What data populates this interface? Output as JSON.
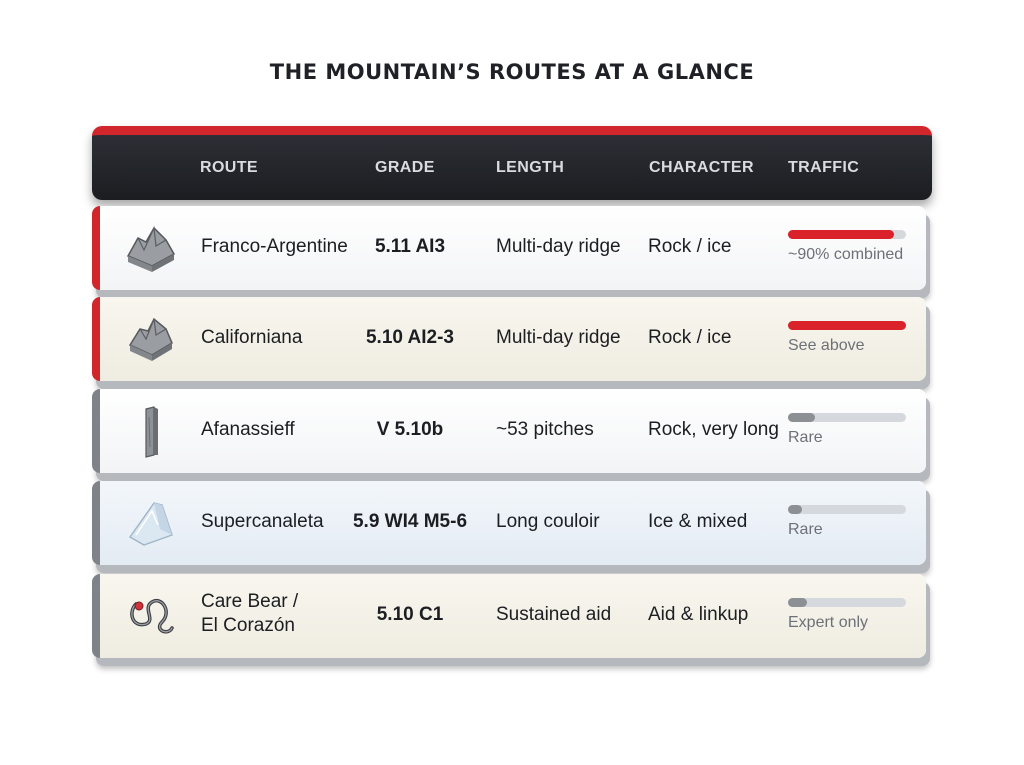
{
  "title": "THE MOUNTAIN’S ROUTES AT A GLANCE",
  "headers": {
    "route": "ROUTE",
    "grade": "GRADE",
    "length": "LENGTH",
    "character": "CHARACTER",
    "traffic": "TRAFFIC"
  },
  "colors": {
    "accent": "#d0262c",
    "header_bg": "#1f2126",
    "traffic_low": "#8c8f94"
  },
  "rows": [
    {
      "route": "Franco-Argentine",
      "grade": "5.11 AI3",
      "length": "Multi-day ridge",
      "character": "Rock / ice",
      "traffic_label": "~90% combined",
      "traffic_level": 0.9,
      "icon": "rock-peak-icon"
    },
    {
      "route": "Californiana",
      "grade": "5.10 AI2-3",
      "length": "Multi-day ridge",
      "character": "Rock / ice",
      "traffic_label": "See above",
      "traffic_level": 1.0,
      "icon": "rock-peak-icon"
    },
    {
      "route": "Afanassieff",
      "grade": "V 5.10b",
      "length": "~53 pitches",
      "character": "Rock, very long",
      "traffic_label": "Rare",
      "traffic_level": 0.23,
      "icon": "rock-pillar-icon"
    },
    {
      "route": "Supercanaleta",
      "grade": "5.9 WI4 M5-6",
      "length": "Long couloir",
      "character": "Ice & mixed",
      "traffic_label": "Rare",
      "traffic_level": 0.12,
      "icon": "ice-block-icon"
    },
    {
      "route_line1": "Care Bear /",
      "route_line2": "El Corazón",
      "grade": "5.10 C1",
      "length": "Sustained aid",
      "character": "Aid & linkup",
      "traffic_label": "Expert only",
      "traffic_level": 0.16,
      "icon": "rope-loop-icon"
    }
  ]
}
